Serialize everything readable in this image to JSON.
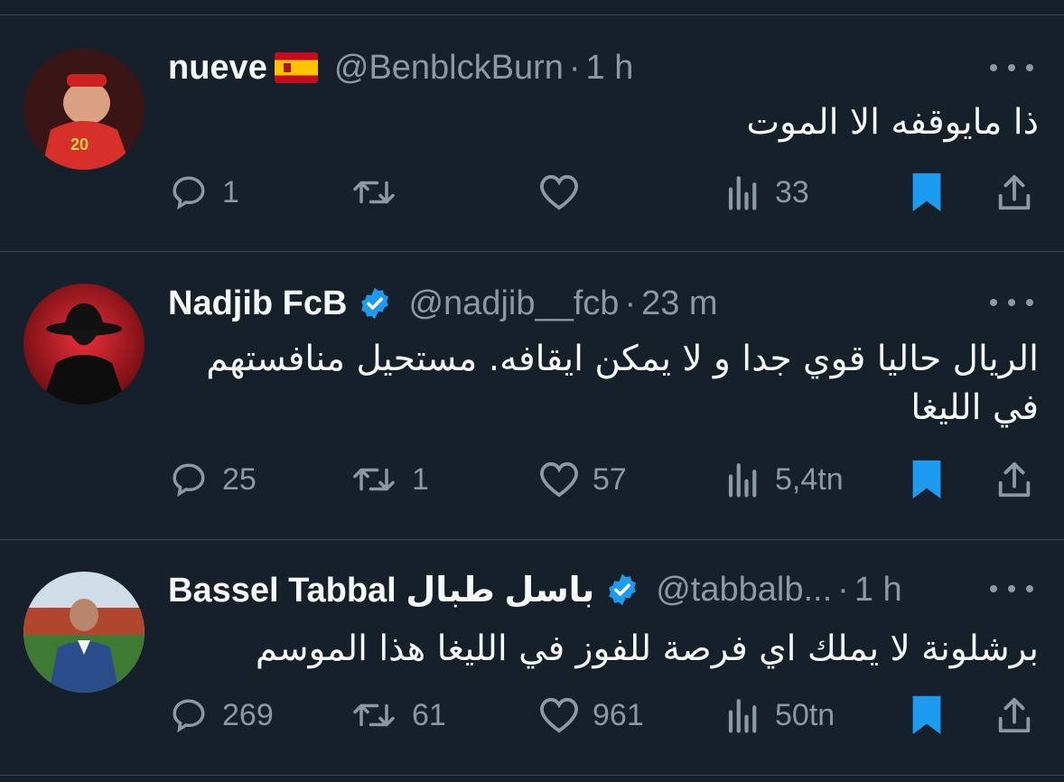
{
  "tweets": [
    {
      "display_name": "nueve",
      "handle": "@BenblckBurn",
      "time": "1 h",
      "text": "ذا مايوقفه الا الموت",
      "replies": "1",
      "retweets": "",
      "likes": "",
      "views": "33",
      "has_flag": "spain-flag-icon",
      "verified": false
    },
    {
      "display_name": "Nadjib FcB",
      "handle": "@nadjib__fcb",
      "time": "23 m",
      "text": "الريال حاليا قوي جدا و لا يمكن ايقافه. مستحيل منافستهم في الليغا",
      "replies": "25",
      "retweets": "1",
      "likes": "57",
      "views": "5,4tn",
      "verified": true
    },
    {
      "display_name": "Bassel Tabbal باسل طبال",
      "handle": "@tabbalb...",
      "time": "1 h",
      "text": "برشلونة لا يملك اي فرصة للفوز في الليغا هذا الموسم",
      "replies": "269",
      "retweets": "61",
      "likes": "961",
      "views": "50tn",
      "verified": true
    }
  ],
  "colors": {
    "background": "#15202b",
    "muted": "#8b98a5",
    "accent": "#1d9bf0",
    "divider": "#38444d"
  }
}
